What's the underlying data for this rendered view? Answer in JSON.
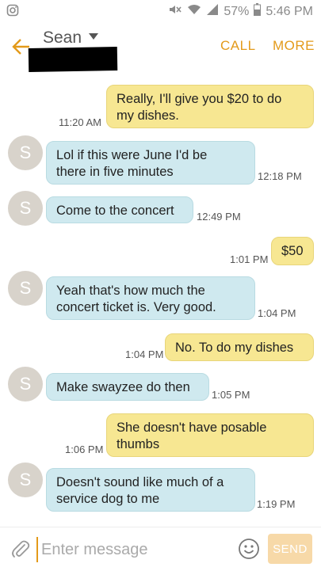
{
  "status_bar": {
    "battery": "57%",
    "time": "5:46 PM",
    "icons": [
      "instagram-icon",
      "mute-icon",
      "wifi-icon",
      "signal-icon",
      "battery-icon"
    ]
  },
  "header": {
    "contact_name": "Sean",
    "call_label": "CALL",
    "more_label": "MORE"
  },
  "messages": [
    {
      "direction": "out",
      "text_lines": [
        "Really, I'll give you $20 to do",
        "my dishes."
      ],
      "time": "11:20 AM"
    },
    {
      "direction": "in",
      "avatar": "S",
      "text_lines": [
        "Lol if this were June I'd be",
        "there in five minutes"
      ],
      "time": "12:18 PM"
    },
    {
      "direction": "in",
      "avatar": "S",
      "text_lines": [
        "Come to the concert"
      ],
      "time": "12:49 PM"
    },
    {
      "direction": "out",
      "text_lines": [
        "$50"
      ],
      "time": "1:01 PM"
    },
    {
      "direction": "in",
      "avatar": "S",
      "text_lines": [
        "Yeah that's how much the",
        "concert ticket is. Very good."
      ],
      "time": "1:04 PM"
    },
    {
      "direction": "out",
      "text_lines": [
        "No. To do my dishes"
      ],
      "time": "1:04 PM"
    },
    {
      "direction": "in",
      "avatar": "S",
      "text_lines": [
        "Make swayzee do then"
      ],
      "time": "1:05 PM"
    },
    {
      "direction": "out",
      "text_lines": [
        "She doesn't have posable",
        "thumbs"
      ],
      "time": "1:06 PM"
    },
    {
      "direction": "in",
      "avatar": "S",
      "text_lines": [
        "Doesn't sound like much of a",
        "service dog to me"
      ],
      "time": "1:19 PM"
    }
  ],
  "composer": {
    "placeholder": "Enter message",
    "send_label": "SEND"
  },
  "colors": {
    "accent": "#e39a1a",
    "outgoing_bubble": "#f7e792",
    "incoming_bubble": "#cfe9ef",
    "avatar_bg": "#d8d3cb"
  }
}
